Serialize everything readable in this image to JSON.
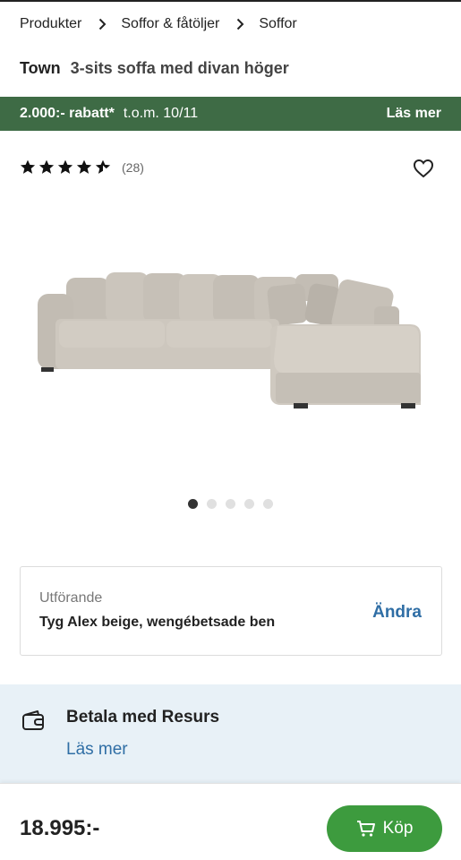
{
  "breadcrumb": {
    "items": [
      "Produkter",
      "Soffor & fåtöljer",
      "Soffor"
    ]
  },
  "product": {
    "brand": "Town",
    "description": "3-sits soffa med divan höger"
  },
  "promo": {
    "rebate": "2.000:- rabatt*",
    "period": "t.o.m. 10/11",
    "read_more": "Läs mer",
    "color": "#3e6b45"
  },
  "rating": {
    "value": 4.5,
    "max": 5,
    "count": "(28)"
  },
  "icons": {
    "favorite": "heart-icon",
    "separator": "chevron-right-icon",
    "payment": "wallet-icon",
    "cart": "cart-icon"
  },
  "gallery": {
    "image": "sofa-image",
    "dots": 5,
    "active_index": 0
  },
  "variant": {
    "label": "Utförande",
    "value": "Tyg Alex beige, wengébetsade ben",
    "change": "Ändra"
  },
  "payment": {
    "title": "Betala med Resurs",
    "link": "Läs mer"
  },
  "footer": {
    "price": "18.995:-",
    "buy_label": "Köp",
    "buy_color": "#3d9b3e"
  }
}
